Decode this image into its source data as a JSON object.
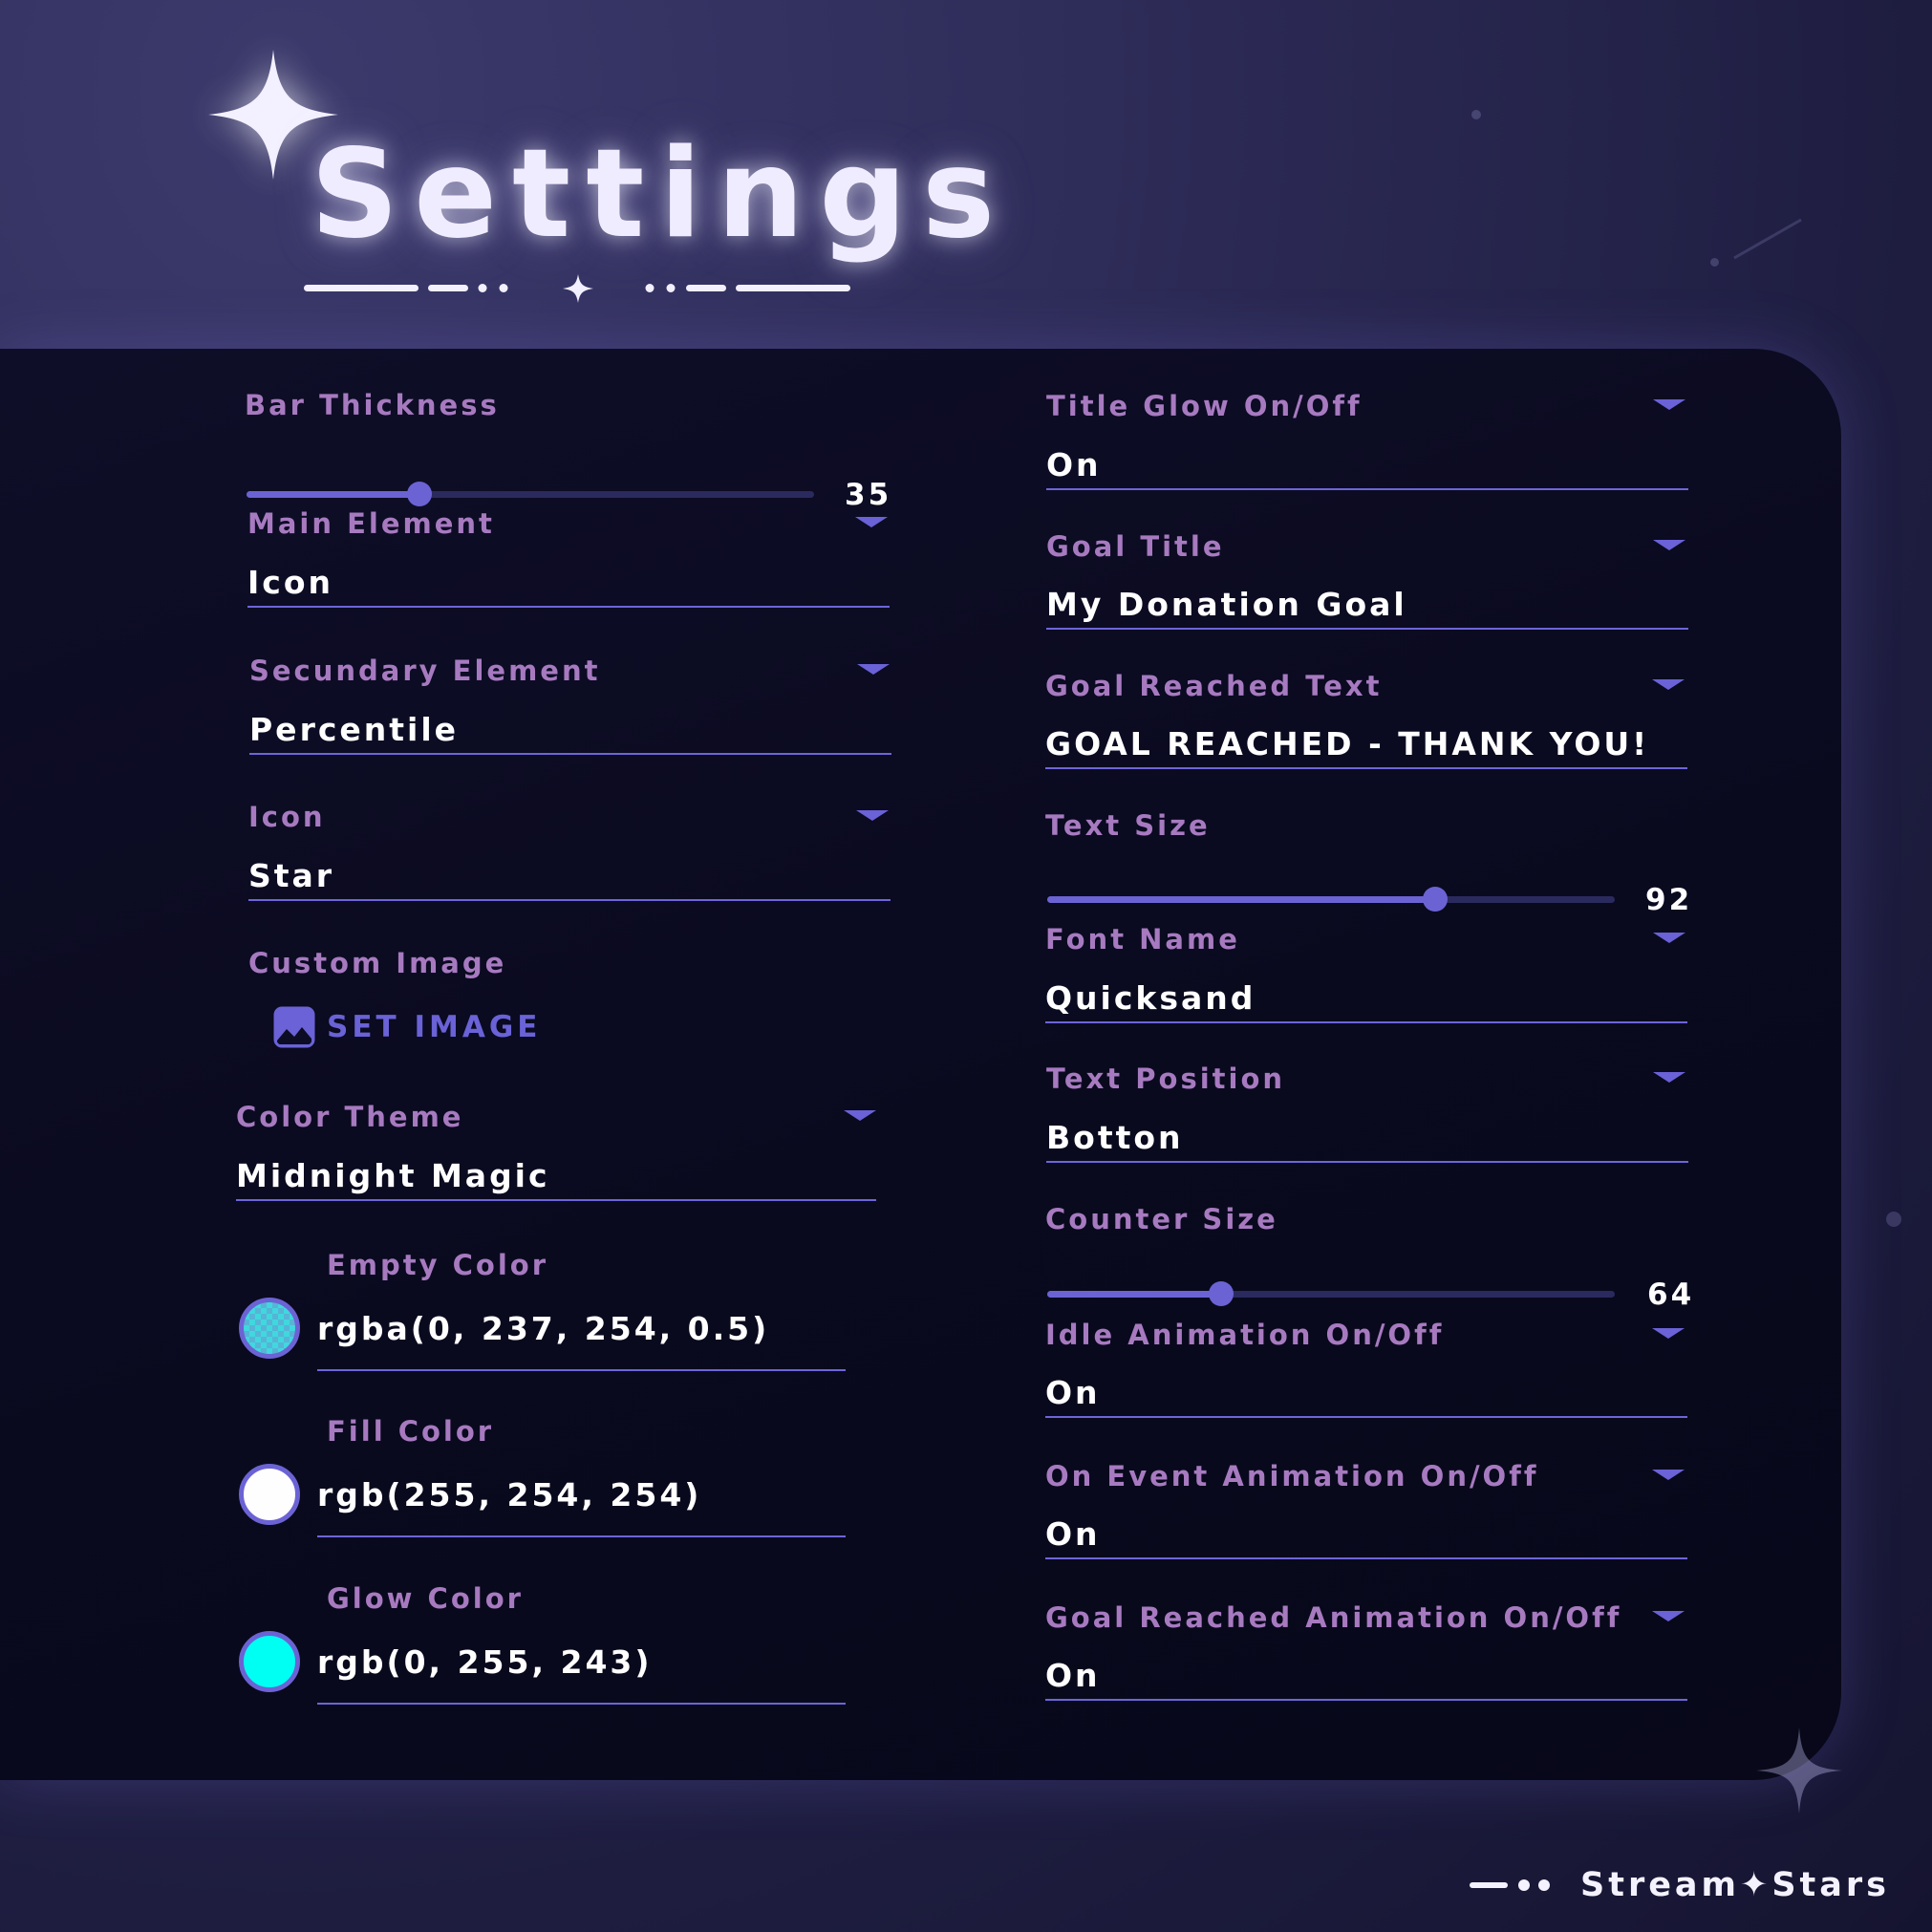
{
  "header": {
    "title": "Settings"
  },
  "left": {
    "bar_thickness": {
      "label": "Bar Thickness",
      "value": "35",
      "level": 0.305
    },
    "main_element": {
      "label": "Main Element",
      "value": "Icon"
    },
    "secundary_element": {
      "label": "Secundary Element",
      "value": "Percentile"
    },
    "icon": {
      "label": "Icon",
      "value": "Star"
    },
    "custom_image": {
      "label": "Custom Image",
      "button": "SET IMAGE",
      "icon": "image-icon"
    },
    "color_theme": {
      "label": "Color Theme",
      "value": "Midnight Magic"
    },
    "empty_color": {
      "label": "Empty Color",
      "value": "rgba(0, 237, 254, 0.5)"
    },
    "fill_color": {
      "label": "Fill Color",
      "value": "rgb(255, 254, 254)",
      "swatch": "#fffefe"
    },
    "glow_color": {
      "label": "Glow Color",
      "value": "rgb(0, 255, 243)",
      "swatch": "#00fff3"
    }
  },
  "right": {
    "title_glow": {
      "label": "Title Glow On/Off",
      "value": "On"
    },
    "goal_title": {
      "label": "Goal Title",
      "value": "My Donation Goal"
    },
    "goal_reached_text": {
      "label": "Goal Reached Text",
      "value": "GOAL REACHED - THANK YOU!"
    },
    "text_size": {
      "label": "Text Size",
      "value": "92",
      "level": 0.683
    },
    "font_name": {
      "label": "Font Name",
      "value": "Quicksand"
    },
    "text_position": {
      "label": "Text Position",
      "value": "Botton"
    },
    "counter_size": {
      "label": "Counter Size",
      "value": "64",
      "level": 0.307
    },
    "idle_animation": {
      "label": "Idle Animation On/Off",
      "value": "On"
    },
    "on_event_animation": {
      "label": "On Event Animation On/Off",
      "value": "On"
    },
    "goal_reached_animation": {
      "label": "Goal Reached Animation On/Off",
      "value": "On"
    }
  },
  "brand": {
    "name": "Stream✦Stars"
  },
  "colors": {
    "accent": "#6b63d4",
    "label": "#a77ac0",
    "panel": "#0a0a20"
  }
}
